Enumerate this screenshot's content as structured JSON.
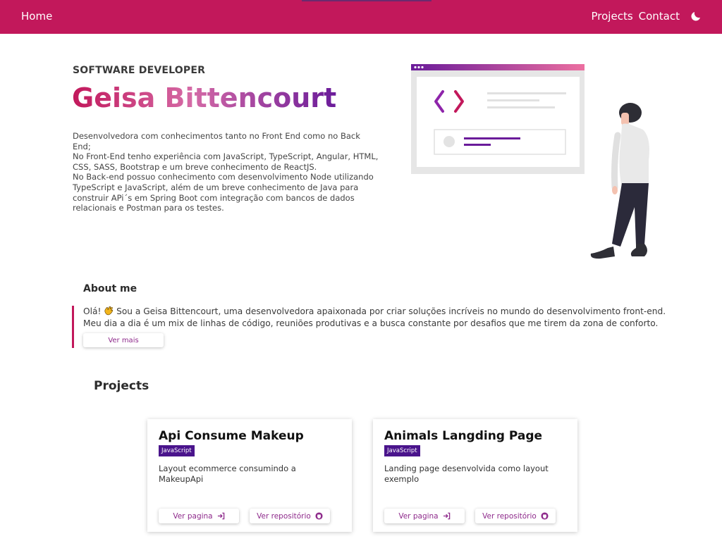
{
  "nav": {
    "home": "Home",
    "projects": "Projects",
    "contact": "Contact",
    "theme_icon": "moon-icon"
  },
  "hero": {
    "role": "SOFTWARE DEVELOPER",
    "name": "Geisa Bittencourt",
    "description": [
      "Desenvolvedora com conhecimentos tanto no Front End como no Back",
      "End;",
      "No Front-End tenho experiência com JavaScript, TypeScript, Angular, HTML,",
      "CSS, SASS, Bootstrap e um breve conhecimento de ReactJS.",
      "No Back-end possuo conhecimento com desenvolvimento Node utilizando",
      "TypeScript e JavaScript, além de um breve conhecimento de Java para",
      "construir APi´s em Spring Boot com integração com bancos de dados",
      "relacionais e Postman para os testes."
    ]
  },
  "about": {
    "title": "About me",
    "line1_prefix": "Olá!",
    "line1_suffix": "Sou a Geisa Bittencourt, uma desenvolvedora apaixonada por criar soluções incríveis no mundo do desenvolvimento front-end.",
    "line2": "Meu dia a dia é um mix de linhas de código, reuniões produtivas e a busca constante por desafios que me tirem da zona de conforto.",
    "button": "Ver mais"
  },
  "projects": {
    "title": "Projects",
    "items": [
      {
        "title": "Api Consume Makeup",
        "tag": "JavaScript",
        "description": "Layout ecommerce consumindo a MakeupApi",
        "page_button": "Ver pagina",
        "repo_button": "Ver repositório"
      },
      {
        "title": "Animals Langding Page",
        "tag": "JavaScript",
        "description": "Landing page desenvolvida como layout exemplo",
        "page_button": "Ver pagina",
        "repo_button": "Ver repositório"
      }
    ]
  },
  "colors": {
    "primary": "#c2185b",
    "secondary": "#4a148c",
    "accent_text": "#8e2a8b"
  }
}
